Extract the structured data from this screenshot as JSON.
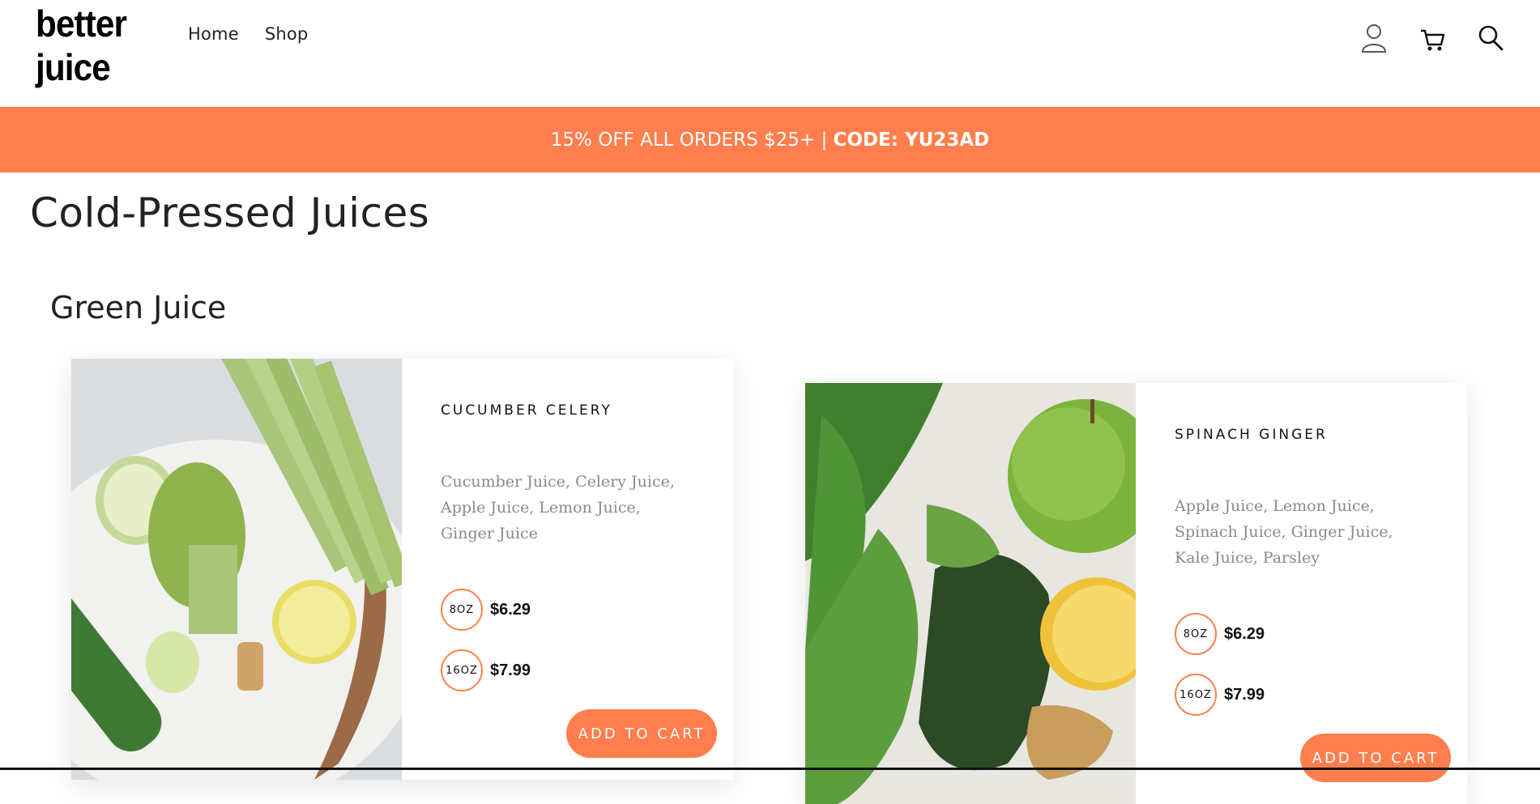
{
  "header": {
    "logo": "better juice",
    "nav": [
      "Home",
      "Shop"
    ],
    "icons": [
      "account-icon",
      "cart-icon",
      "search-icon"
    ]
  },
  "promo": {
    "text": "15% OFF ALL ORDERS $25+ | ",
    "code": "CODE: YU23AD"
  },
  "page": {
    "title": "Cold-Pressed Juices",
    "section_title": "Green Juice"
  },
  "products": [
    {
      "name": "CUCUMBER CELERY",
      "ingredients": "Cucumber Juice, Celery Juice, Apple Juice, Lemon Juice, Ginger Juice",
      "sizes": [
        {
          "size": "8OZ",
          "price": "$6.29"
        },
        {
          "size": "16OZ",
          "price": "$7.99"
        }
      ],
      "cta": "ADD TO CART"
    },
    {
      "name": "SPINACH GINGER",
      "ingredients": "Apple Juice, Lemon Juice, Spinach Juice, Ginger Juice, Kale Juice, Parsley",
      "sizes": [
        {
          "size": "8OZ",
          "price": "$6.29"
        },
        {
          "size": "16OZ",
          "price": "$7.99"
        }
      ],
      "cta": "ADD TO CART"
    }
  ],
  "colors": {
    "accent": "#ff7e4d",
    "text": "#222222",
    "muted": "#8a8a8a"
  }
}
